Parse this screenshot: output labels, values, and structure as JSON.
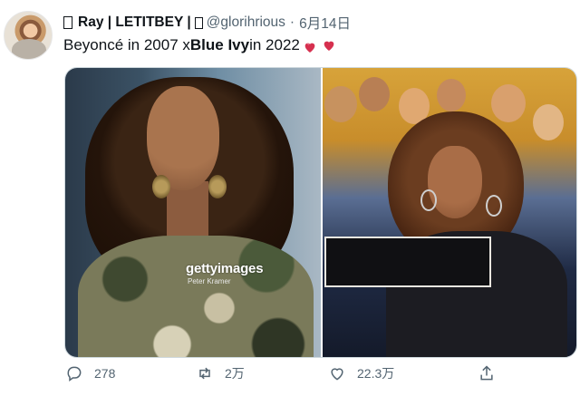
{
  "tweet": {
    "display_name": "Ray | LETITBEY |",
    "handle": "@glorihrious",
    "separator": "·",
    "date": "6月14日",
    "text_parts": [
      "Beyoncé in 2007 x ",
      "Blue Ivy",
      " in 2022 "
    ]
  },
  "media": {
    "left": {
      "watermark": "gettyimages",
      "credit": "Peter Kramer"
    }
  },
  "actions": {
    "reply_count": "278",
    "retweet_count": "2万",
    "like_count": "22.3万"
  },
  "icons": [
    "reply-icon",
    "retweet-icon",
    "like-icon",
    "share-icon",
    "heart-emoji-icon"
  ],
  "colors": {
    "secondary_text": "#536471",
    "primary_text": "#0f1419",
    "heart_emoji": "#d6304f"
  }
}
